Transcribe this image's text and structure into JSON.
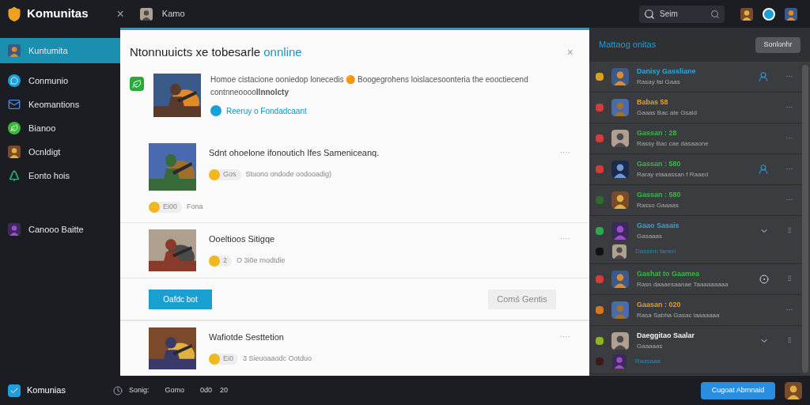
{
  "topbar": {
    "app_name": "Komunitas",
    "close": "×",
    "user": "Kamo",
    "search": {
      "value": "Seim"
    }
  },
  "sidebar": {
    "items": [
      {
        "label": "Kuntumita",
        "selected": true,
        "kind": "avatar"
      },
      {
        "label": "Conmunio",
        "selected": false,
        "kind": "chat"
      },
      {
        "label": "Keomantions",
        "selected": false,
        "kind": "mail"
      },
      {
        "label": "Bianoo",
        "selected": false,
        "kind": "leaf"
      },
      {
        "label": "Ocnldigt",
        "selected": false,
        "kind": "avatar"
      },
      {
        "label": "Eonto hois",
        "selected": false,
        "kind": "tree"
      }
    ],
    "footer_item": {
      "label": "Canooo Baitte"
    }
  },
  "modal": {
    "title": "Ntonnuuicts xe tobesarle",
    "title_highlight": "onnline",
    "close": "×",
    "posts": [
      {
        "kind": "news",
        "text": "Homoe cistacione ooniedop lonecedis 🟠 Boogegrohens loislacesoonteria the eooctiecend contnneoooo**llnnolcty**",
        "link": "Reeruy o Fondadcaant"
      },
      {
        "kind": "post",
        "title": "Sdnt ohoelone ifonoutich Ifes Sameniceanq.",
        "pill": "Gos",
        "meta": "Stuono ondode oodooadig)",
        "more": "····",
        "extra_pill": "Ei00",
        "extra_meta": "Fona"
      },
      {
        "kind": "post",
        "title": "Ooeltioos Sitigqe",
        "pill": "2",
        "meta": "O 3i0e rnodtdie",
        "more": "····"
      },
      {
        "kind": "actions",
        "primary": "Oafdc bot",
        "secondary": "Comś Gentis"
      },
      {
        "kind": "post",
        "title": "Wafiotde Sesttetion",
        "pill": "Ei0",
        "meta": "3 Sieuoaaodc Ootduo",
        "more": "····"
      }
    ]
  },
  "friends": {
    "title": "Mattaog onitas",
    "button": "Sonlonhr",
    "items": [
      {
        "name": {
          "text": "Danisy Gassliane",
          "color": "#35a3d6"
        },
        "status": "Rasay fal Gaas",
        "color": "#d9a21b",
        "kind": "person",
        "more": "···"
      },
      {
        "name": {
          "text": "Babas 58",
          "color": "#e0a020"
        },
        "status": "Gaaas Bac ate Gsald",
        "color": "#d83a3a",
        "kind": "plain",
        "more": "···"
      },
      {
        "name": {
          "text": "Gassan : 28",
          "color": "#3cb54a"
        },
        "status": "Rassy Bac cae dasaaone",
        "color": "#d83a3a",
        "kind": "plain",
        "more": "···"
      },
      {
        "name": {
          "text": "Gassan : 580",
          "color": "#3cb54a"
        },
        "status": "Raray elaaassan f Raaed",
        "color": "#d83a3a",
        "kind": "person",
        "more": "···"
      },
      {
        "name": {
          "text": "Gassan : 580",
          "color": "#3cb54a"
        },
        "status": "Rasso Gaaaas",
        "color": "#2f6b2f",
        "kind": "plain",
        "more": "···"
      },
      {
        "name": {
          "text": "Gaao Sasais",
          "color": "#35a3d6"
        },
        "status": "Gasaaas",
        "color": "#2ea84a",
        "kind": "chevron",
        "more": "⁝⁝",
        "sub": {
          "name": "Dassinn tanen",
          "color": "#111111"
        }
      },
      {
        "name": {
          "text": "Gashat to Gaamea",
          "color": "#3cb54a"
        },
        "status": "Rasn daaaesaanae Taaaaaaaaa",
        "color": "#d83a3a",
        "kind": "circle",
        "more": "⁝⁝"
      },
      {
        "name": {
          "text": "Gaasan : 020",
          "color": "#e0a020"
        },
        "status": "Rasa Sabha Gasac laaaaaaa",
        "color": "#d9761b",
        "kind": "plain",
        "more": "···"
      },
      {
        "name": {
          "text": "Daeggitao Saalar",
          "color": "#f3f3f3"
        },
        "status": "Gaaaaas",
        "color": "#8cb520",
        "kind": "chevron",
        "more": "⁝⁝",
        "sub": {
          "name": "Raasaaa",
          "color": "#3a1a1a"
        }
      }
    ]
  },
  "bottombar": {
    "app_name": "Komunias",
    "items": [
      "Sonig:",
      "Gomo",
      "0d0",
      "20"
    ],
    "button": "Cugoat Abmnaid"
  }
}
